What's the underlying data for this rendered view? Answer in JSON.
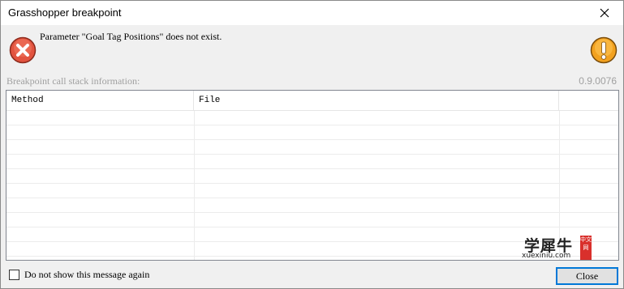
{
  "window": {
    "title": "Grasshopper breakpoint",
    "close_icon": "close-icon"
  },
  "message": {
    "text": "Parameter \"Goal Tag Positions\" does not exist.",
    "error_icon": "error-x-icon",
    "warning_icon": "exclamation-warning-icon"
  },
  "stack": {
    "caption": "Breakpoint call stack information:",
    "version": "0.9.0076",
    "columns": [
      "Method",
      "File",
      ""
    ],
    "rows": []
  },
  "footer": {
    "checkbox_label": "Do not show this message again",
    "checkbox_checked": false,
    "close_label": "Close"
  },
  "watermark": {
    "main": "学犀牛",
    "sub": "xuexiniu.com",
    "badge": "中文网"
  },
  "colors": {
    "accent": "#0078d7",
    "error_red": "#e0443a",
    "warning_orange": "#f29a1f"
  }
}
